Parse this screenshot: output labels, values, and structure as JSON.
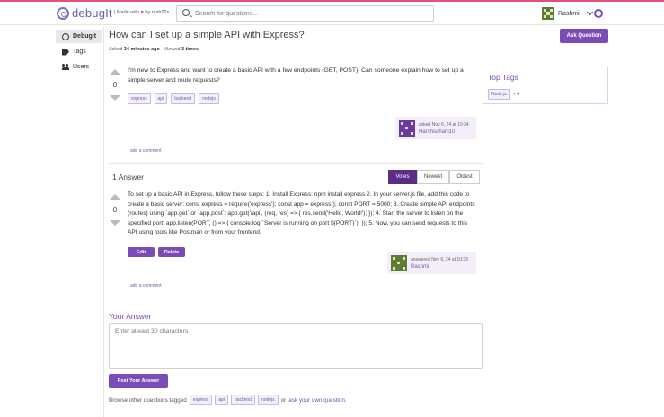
{
  "header": {
    "logo_text": "debugIt",
    "made_with_prefix": "| Made with",
    "made_with_heart": "♥",
    "made_with_suffix": "by rash22s",
    "search_placeholder": "Search for questions...",
    "user_name": "Rashmi"
  },
  "sidebar": {
    "items": [
      {
        "label": "Debugit",
        "icon": "globe-icon",
        "active": true
      },
      {
        "label": "Tags",
        "icon": "tag-icon",
        "active": false
      },
      {
        "label": "Users",
        "icon": "users-icon",
        "active": false
      }
    ]
  },
  "question": {
    "title": "How can I set up a simple API with Express?",
    "asked_label": "Asked",
    "asked_value": "34 minutes ago",
    "viewed_label": "Viewed",
    "viewed_value": "3 times",
    "votes": "0",
    "body": "I'm new to Express and want to create a basic API with a few endpoints (GET, POST). Can someone explain how to set up a simple server and route requests?",
    "tags": [
      "express",
      "api",
      "backend",
      "nodejs"
    ],
    "asked_meta": "asked Nov 6, 24 at 10:34",
    "author": "Harshsahani10",
    "add_comment": "add a comment"
  },
  "ask_button": "Ask Question",
  "top_tags": {
    "title": "Top Tags",
    "tag": "Node.js",
    "count": "× 4"
  },
  "answers": {
    "count_label": "1 Answer",
    "sort": [
      "Votes",
      "Newest",
      "Oldest"
    ],
    "items": [
      {
        "votes": "0",
        "body": "To set up a basic API in Express, follow these steps: 1. Install Express: npm install express 2. In your server.js file, add this code to create a basic server: const express = require('express'); const app = express(); const PORT = 5000; 3. Create simple API endpoints (routes) using `app.get` or `app.post`: app.get('/api', (req, res) => { res.send('Hello, World!'); }); 4. Start the server to listen on the specified port: app.listen(PORT, () => { console.log(`Server is running on port ${PORT}`); }); 5. Now, you can send requests to this API using tools like Postman or from your frontend.",
        "edit_label": "Edit",
        "delete_label": "Delete",
        "answered_meta": "answered Nov 6, 24 at 10:39",
        "author": "Rashmi",
        "add_comment": "add a comment"
      }
    ]
  },
  "your_answer": {
    "title": "Your Answer",
    "placeholder": "Enter atleast 30 characters",
    "post_button": "Post Your Answer"
  },
  "browse": {
    "prefix": "Browse other questions tagged",
    "tags": [
      "express",
      "api",
      "backend",
      "nodejs"
    ],
    "or": "or",
    "link": "ask your own question."
  }
}
